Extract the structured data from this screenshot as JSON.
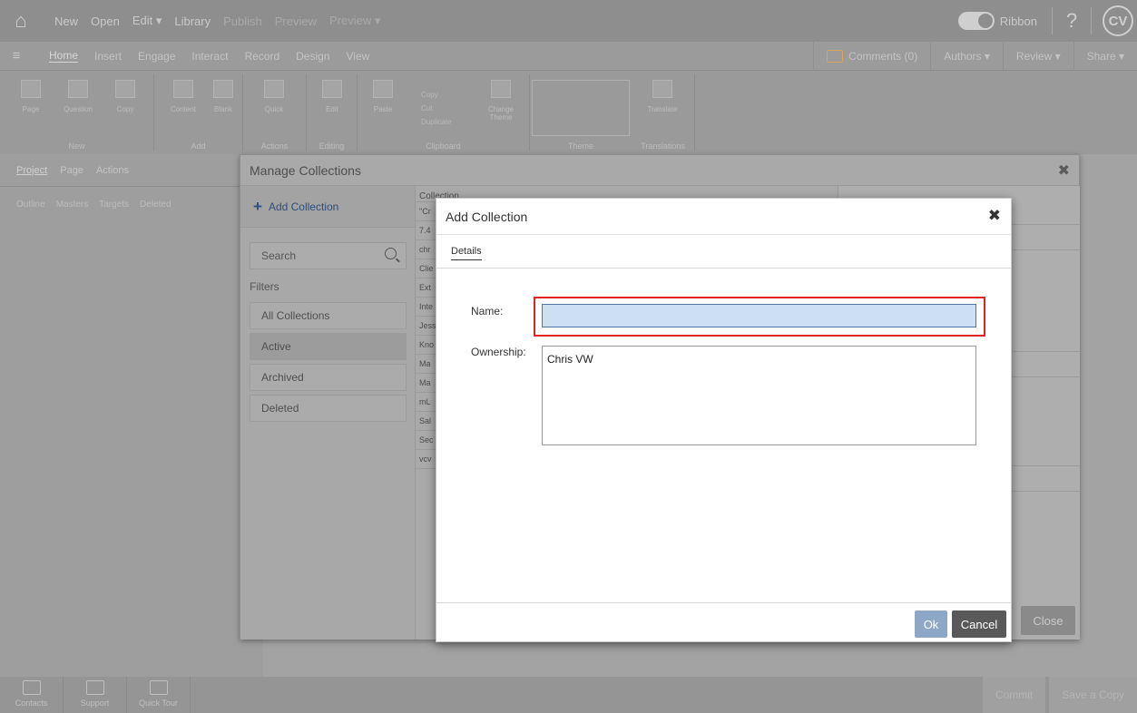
{
  "topbar": {
    "items": [
      "New",
      "Open",
      "Edit ▾",
      "Library",
      "Publish",
      "Preview",
      "Preview ▾"
    ],
    "ribbon_label": "Ribbon",
    "help": "?",
    "avatar": "CV"
  },
  "tabs": {
    "menu_icon": "≡",
    "items": [
      "Home",
      "Insert",
      "Engage",
      "Interact",
      "Record",
      "Design",
      "View"
    ],
    "comments": "Comments (0)",
    "authors": "Authors ▾",
    "review": "Review ▾",
    "share": "Share ▾"
  },
  "ribbon": {
    "groups": {
      "new": "New",
      "add": "Add",
      "actions": "Actions",
      "editing": "Editing",
      "clipboard": "Clipboard",
      "theme": "Theme",
      "translations": "Translations"
    },
    "buttons": {
      "page": "Page",
      "question": "Question",
      "copy": "Copy",
      "content": "Content",
      "blank": "Blank",
      "quick": "Quick",
      "edit": "Edit",
      "paste": "Paste",
      "copy_small": "Copy",
      "cut": "Cut",
      "duplicate": "Duplicate",
      "change_theme": "Change Theme",
      "translate": "Translate"
    }
  },
  "leftnav": {
    "tabs": [
      "Project",
      "Page",
      "Actions"
    ],
    "subtabs": [
      "Outline",
      "Masters",
      "Targets",
      "Deleted"
    ]
  },
  "bottombar": {
    "items": [
      "Contacts",
      "Support",
      "Quick Tour"
    ],
    "commit": "Commit",
    "save_copy": "Save a Copy"
  },
  "manage": {
    "title": "Manage Collections",
    "close_icon": "✖",
    "add_collection": "Add Collection",
    "search_placeholder": "Search",
    "filters_label": "Filters",
    "filters": [
      "All Collections",
      "Active",
      "Archived",
      "Deleted"
    ],
    "list_header": "Collection",
    "list_rows": [
      "\"Cr",
      "7.4",
      "chr",
      "Clie",
      "Ext",
      "Inte",
      "Jess",
      "Kno",
      "Ma",
      "Ma",
      "mL",
      "Sal",
      "Sec",
      "vcv"
    ],
    "close_button": "Close"
  },
  "add_dialog": {
    "title": "Add Collection",
    "close_icon": "✖",
    "tab": "Details",
    "name_label": "Name:",
    "name_value": "",
    "ownership_label": "Ownership:",
    "ownership_value": "Chris VW",
    "ok": "Ok",
    "cancel": "Cancel"
  }
}
